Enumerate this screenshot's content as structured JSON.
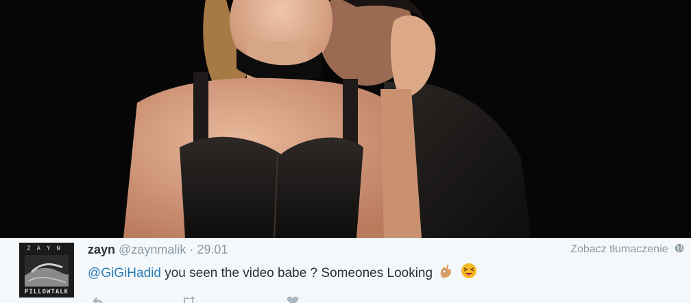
{
  "tweet": {
    "author_name": "zayn",
    "author_handle": "@zaynmalik",
    "separator": "·",
    "date": "29.01",
    "translate_label": "Zobacz tłumaczenie",
    "mention": "@GiGiHadid",
    "text": "you seen the video babe ?  Someones Looking"
  },
  "avatar": {
    "letters": "ZAYN",
    "caption": "PILLOWTALK"
  },
  "icons": {
    "translate": "globe-icon",
    "reply": "reply-icon",
    "retweet": "retweet-icon",
    "like": "heart-icon",
    "emoji_1": "ok-hand-emoji",
    "emoji_2": "squinting-tongue-face-emoji"
  },
  "colors": {
    "mention": "#2b7bb9",
    "muted": "#8899a6",
    "background": "#f5f8fa"
  }
}
